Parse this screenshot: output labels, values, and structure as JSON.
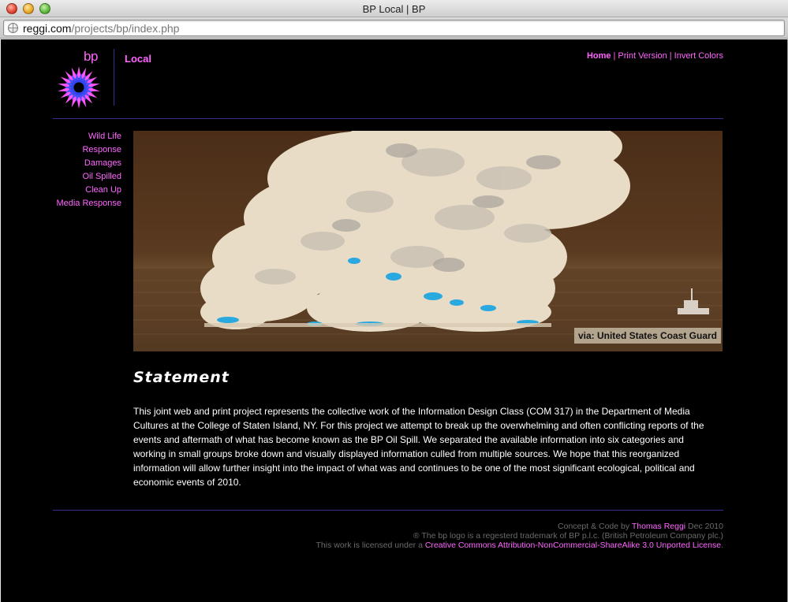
{
  "window": {
    "title": "BP Local | BP"
  },
  "urlbar": {
    "host": "reggi.com",
    "path": "/projects/bp/index.php"
  },
  "logo": {
    "text": "bp"
  },
  "site": {
    "name": "Local"
  },
  "topnav": {
    "items": [
      {
        "label": "Home",
        "active": true
      },
      {
        "label": "Print Version"
      },
      {
        "label": "Invert Colors"
      }
    ],
    "separator": "|"
  },
  "sidenav": {
    "items": [
      {
        "label": "Wild Life"
      },
      {
        "label": "Response"
      },
      {
        "label": "Damages"
      },
      {
        "label": "Oil Spilled"
      },
      {
        "label": "Clean Up"
      },
      {
        "label": "Media Response"
      }
    ]
  },
  "hero": {
    "caption": "via: United States Coast Guard"
  },
  "statement": {
    "title": "Statement",
    "body": "This joint web and print project represents the collective work of the Information Design Class (COM 317) in the Department of Media Cultures at the College of Staten Island, NY. For this project we attempt to break up the overwhelming and often conflicting reports of the events and aftermath of what has become known as the BP Oil Spill. We separated the available information into six categories and working in small groups broke down and visually displayed information culled from multiple sources. We hope that this reorganized information will allow further insight into the impact of what was and continues to be one of the most significant ecological, political and economic events of 2010."
  },
  "footer": {
    "line1_prefix": "Concept & Code by ",
    "line1_link": "Thomas Reggi",
    "line1_suffix": " Dec 2010",
    "line2": "® The bp logo is a regesterd trademark of BP p.l.c. (British Petroleum Company plc.)",
    "line3_prefix": "This work is licensed under a ",
    "line3_link": "Creative Commons Attribution-NonCommercial-ShareAlike 3.0 Unported License",
    "line3_suffix": "."
  },
  "colors": {
    "accent": "#ff66ff",
    "divider": "#3a2f8f",
    "background": "#000000"
  }
}
